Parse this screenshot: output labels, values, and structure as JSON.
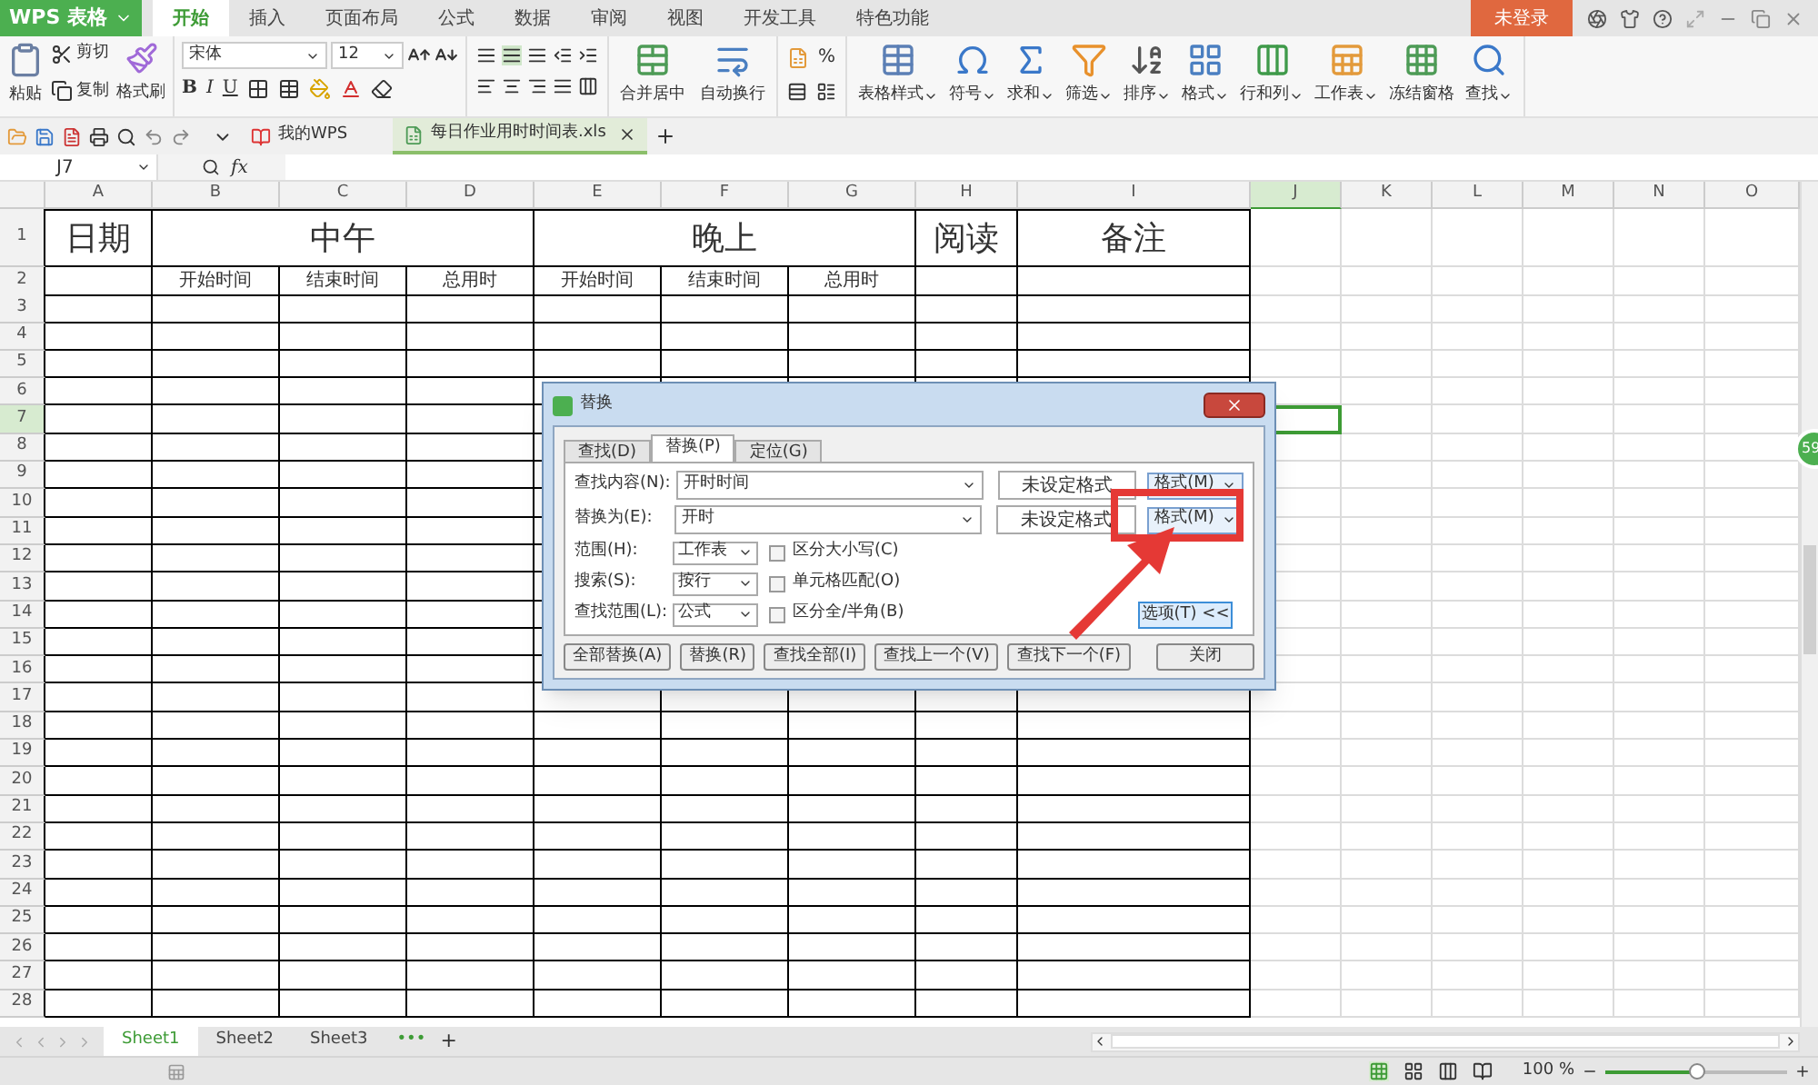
{
  "app_menu": {
    "label": "WPS 表格"
  },
  "ribbon_tabs": [
    {
      "label": "开始",
      "selected": true
    },
    {
      "label": "插入",
      "selected": false
    },
    {
      "label": "页面布局",
      "selected": false
    },
    {
      "label": "公式",
      "selected": false
    },
    {
      "label": "数据",
      "selected": false
    },
    {
      "label": "审阅",
      "selected": false
    },
    {
      "label": "视图",
      "selected": false
    },
    {
      "label": "开发工具",
      "selected": false
    },
    {
      "label": "特色功能",
      "selected": false
    }
  ],
  "account": {
    "label": "未登录"
  },
  "clipboard": {
    "paste": "粘贴",
    "cut": "剪切",
    "copy": "复制",
    "format_painter": "格式刷"
  },
  "font": {
    "name": "宋体",
    "size": "12",
    "bold": "B",
    "italic": "I",
    "underline": "U"
  },
  "alignment": {
    "merge": "合并居中",
    "wrap": "自动换行"
  },
  "number": {
    "percent": "%"
  },
  "tools": [
    {
      "label": "表格样式",
      "kind": "table_style",
      "dropdown": true
    },
    {
      "label": "符号",
      "kind": "symbol",
      "dropdown": true
    },
    {
      "label": "求和",
      "kind": "sum",
      "dropdown": true
    },
    {
      "label": "筛选",
      "kind": "filter",
      "dropdown": true
    },
    {
      "label": "排序",
      "kind": "sort",
      "dropdown": true
    },
    {
      "label": "格式",
      "kind": "format",
      "dropdown": true
    },
    {
      "label": "行和列",
      "kind": "rows_cols",
      "dropdown": true
    },
    {
      "label": "工作表",
      "kind": "sheet",
      "dropdown": true
    },
    {
      "label": "冻结窗格",
      "kind": "freeze",
      "dropdown": false
    },
    {
      "label": "查找",
      "kind": "find",
      "dropdown": true
    }
  ],
  "doc_tabs": [
    {
      "label": "我的WPS",
      "kind": "home",
      "selected": false
    },
    {
      "label": "每日作业用时时间表.xls",
      "kind": "file",
      "selected": true
    }
  ],
  "formula_bar": {
    "cell": "J7",
    "fx": "fx"
  },
  "sheet": {
    "columns": [
      {
        "label": "A",
        "selected": false
      },
      {
        "label": "B",
        "selected": false
      },
      {
        "label": "C",
        "selected": false
      },
      {
        "label": "D",
        "selected": false
      },
      {
        "label": "E",
        "selected": false
      },
      {
        "label": "F",
        "selected": false
      },
      {
        "label": "G",
        "selected": false
      },
      {
        "label": "H",
        "selected": false
      },
      {
        "label": "I",
        "selected": false
      },
      {
        "label": "J",
        "selected": true
      },
      {
        "label": "K",
        "selected": false
      },
      {
        "label": "L",
        "selected": false
      },
      {
        "label": "M",
        "selected": false
      },
      {
        "label": "N",
        "selected": false
      },
      {
        "label": "O",
        "selected": false
      }
    ],
    "rows": [
      {
        "label": "1",
        "selected": false
      },
      {
        "label": "2",
        "selected": false
      },
      {
        "label": "3",
        "selected": false
      },
      {
        "label": "4",
        "selected": false
      },
      {
        "label": "5",
        "selected": false
      },
      {
        "label": "6",
        "selected": false
      },
      {
        "label": "7",
        "selected": true
      },
      {
        "label": "8",
        "selected": false
      },
      {
        "label": "9",
        "selected": false
      },
      {
        "label": "10",
        "selected": false
      },
      {
        "label": "11",
        "selected": false
      },
      {
        "label": "12",
        "selected": false
      },
      {
        "label": "13",
        "selected": false
      },
      {
        "label": "14",
        "selected": false
      },
      {
        "label": "15",
        "selected": false
      },
      {
        "label": "16",
        "selected": false
      },
      {
        "label": "17",
        "selected": false
      },
      {
        "label": "18",
        "selected": false
      },
      {
        "label": "19",
        "selected": false
      },
      {
        "label": "20",
        "selected": false
      },
      {
        "label": "21",
        "selected": false
      },
      {
        "label": "22",
        "selected": false
      },
      {
        "label": "23",
        "selected": false
      },
      {
        "label": "24",
        "selected": false
      },
      {
        "label": "25",
        "selected": false
      },
      {
        "label": "26",
        "selected": false
      },
      {
        "label": "27",
        "selected": false
      },
      {
        "label": "28",
        "selected": false
      }
    ],
    "row1": [
      "日期",
      "中午",
      "晚上",
      "阅读",
      "备注"
    ],
    "row2": [
      "开始时间",
      "结束时间",
      "总用时",
      "开始时间",
      "结束时间",
      "总用时"
    ]
  },
  "dialog": {
    "title": "替换",
    "tabs": [
      {
        "label": "查找(D)",
        "selected": false
      },
      {
        "label": "替换(P)",
        "selected": true
      },
      {
        "label": "定位(G)",
        "selected": false
      }
    ],
    "fields": [
      {
        "label": "查找内容(N):",
        "value": "开时时间",
        "format_status": "未设定格式",
        "format_button": "格式(M)"
      },
      {
        "label": "替换为(E):",
        "value": "开时",
        "format_status": "未设定格式",
        "format_button": "格式(M)"
      }
    ],
    "options": [
      {
        "label": "范围(H):",
        "value": "工作表",
        "checkbox": "区分大小写(C)",
        "checked": false
      },
      {
        "label": "搜索(S):",
        "value": "按行",
        "checkbox": "单元格匹配(O)",
        "checked": false
      },
      {
        "label": "查找范围(L):",
        "value": "公式",
        "checkbox": "区分全/半角(B)",
        "checked": false
      }
    ],
    "options_button": "选项(T) <<",
    "buttons": [
      "全部替换(A)",
      "替换(R)",
      "查找全部(I)",
      "查找上一个(V)",
      "查找下一个(F)",
      "关闭"
    ]
  },
  "sheet_tabs": [
    {
      "label": "Sheet1",
      "selected": true
    },
    {
      "label": "Sheet2",
      "selected": false
    },
    {
      "label": "Sheet3",
      "selected": false
    }
  ],
  "sheet_more": "•••",
  "sheet_add": "+",
  "status": {
    "zoom": "100 %",
    "zoom_slider": {
      "level": 0.5
    }
  },
  "side_badge": "59"
}
